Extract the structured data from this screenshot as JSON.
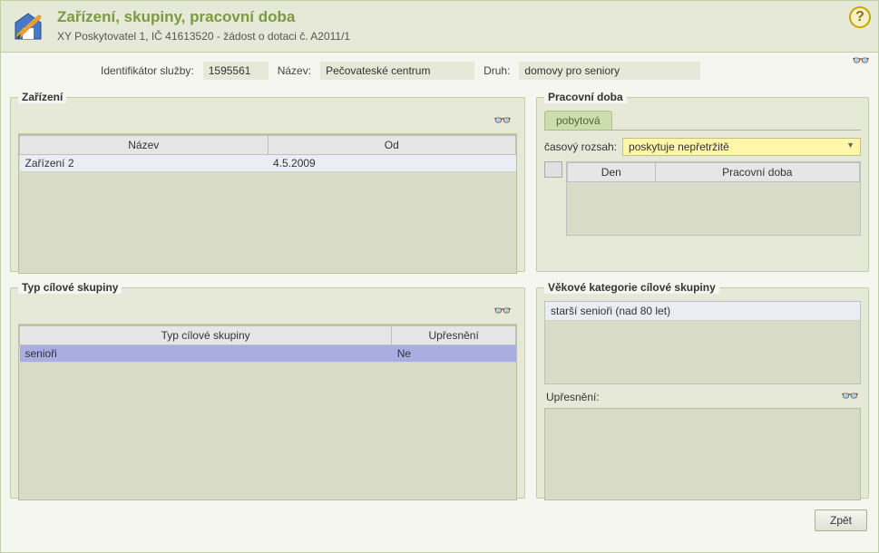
{
  "header": {
    "title": "Zařízení, skupiny, pracovní doba",
    "subtitle": "XY Poskytovatel 1, IČ 41613520 - žádost o dotaci č. A2011/1"
  },
  "service": {
    "id_label": "Identifikátor služby:",
    "id_value": "1595561",
    "name_label": "Název:",
    "name_value": "Pečovateské centrum",
    "type_label": "Druh:",
    "type_value": "domovy pro seniory"
  },
  "zarizeni": {
    "legend": "Zařízení",
    "columns": {
      "name": "Název",
      "from": "Od"
    },
    "rows": [
      {
        "name": "Zařízení 2",
        "from": "4.5.2009"
      }
    ]
  },
  "typcs": {
    "legend": "Typ cílové skupiny",
    "columns": {
      "type": "Typ cílové skupiny",
      "upresneni": "Upřesnění"
    },
    "rows": [
      {
        "type": "senioři",
        "upresneni": "Ne"
      }
    ]
  },
  "pracdoba": {
    "legend": "Pracovní doba",
    "tab": "pobytová",
    "rozsah_label": "časový rozsah:",
    "rozsah_value": "poskytuje nepřetržitě",
    "columns": {
      "day": "Den",
      "hours": "Pracovní doba"
    }
  },
  "vekove": {
    "legend": "Věkové kategorie cílové skupiny",
    "rows": [
      "starší senioři (nad 80 let)"
    ],
    "upresneni_label": "Upřesnění:"
  },
  "footer": {
    "back": "Zpět"
  },
  "icons": {
    "help": "?",
    "glasses": "👓"
  }
}
